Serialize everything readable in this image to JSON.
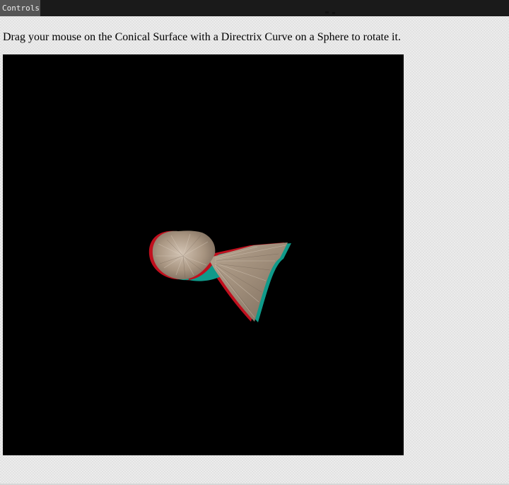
{
  "controls": {
    "label": "Controls"
  },
  "instructions": {
    "text": "Drag your mouse on the Conical Surface with a Directrix Curve on a Sphere to rotate it."
  },
  "viewport": {
    "background": "#000000",
    "surface_color": "#a4927f",
    "anaglyph_left_color": "#d01020",
    "anaglyph_right_color": "#10a090"
  }
}
